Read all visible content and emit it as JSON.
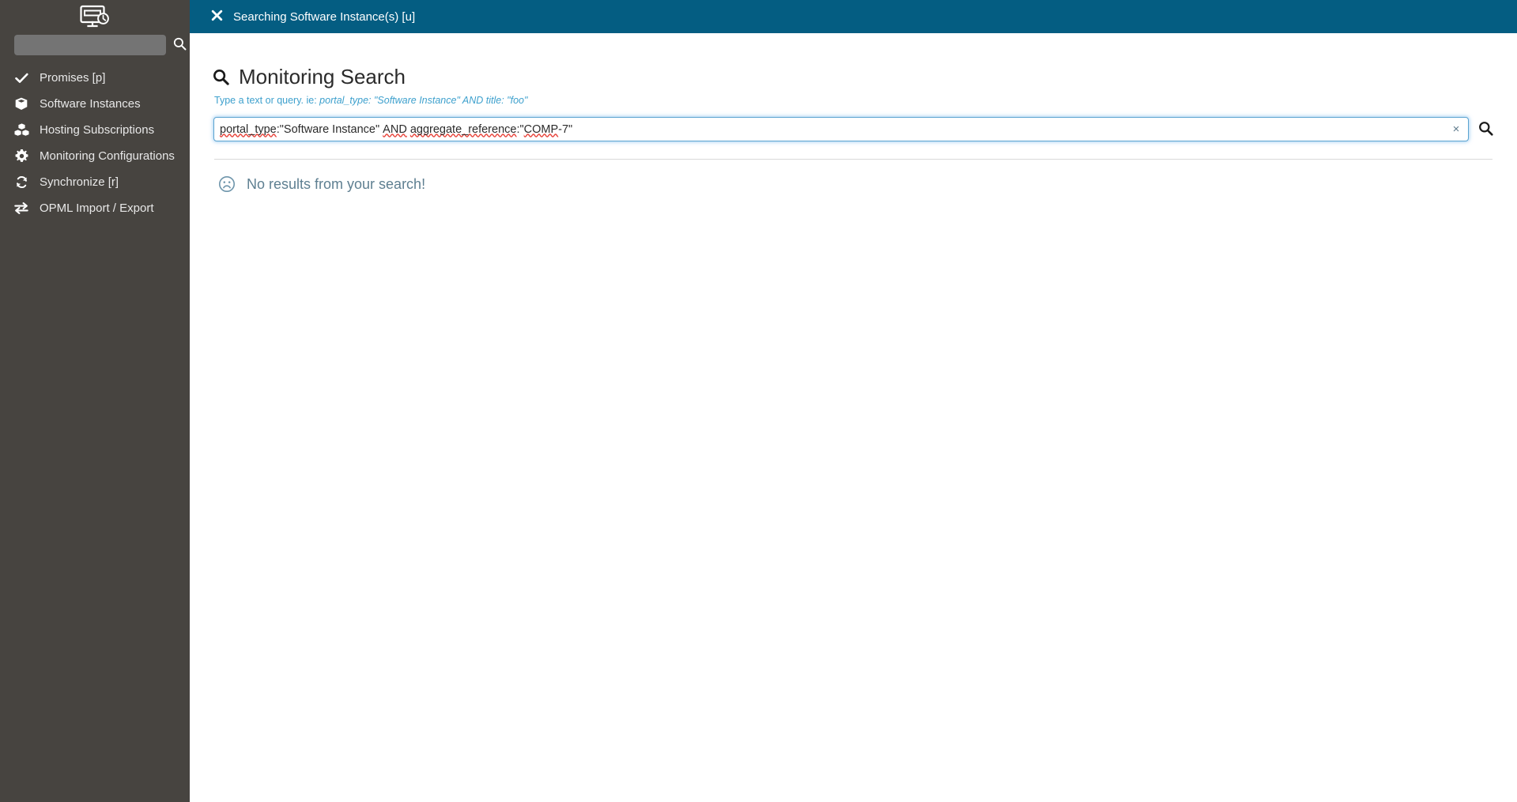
{
  "sidebar": {
    "logo_icon": "monitor-clock-icon",
    "search": {
      "value": "",
      "placeholder": "",
      "icon": "search-icon"
    },
    "items": [
      {
        "label": "Promises [p]",
        "icon": "check-icon"
      },
      {
        "label": "Software Instances",
        "icon": "cube-icon"
      },
      {
        "label": "Hosting Subscriptions",
        "icon": "cubes-icon"
      },
      {
        "label": "Monitoring Configurations",
        "icon": "gear-icon"
      },
      {
        "label": "Synchronize [r]",
        "icon": "sync-icon"
      },
      {
        "label": "OPML Import / Export",
        "icon": "exchange-icon"
      }
    ]
  },
  "topbar": {
    "close_icon": "close-icon",
    "title": "Searching Software Instance(s) [u]"
  },
  "page": {
    "icon": "search-icon",
    "title": "Monitoring Search",
    "hint_prefix": "Type a text or query. ie: ",
    "hint_example": "portal_type: \"Software Instance\" AND title: \"foo\""
  },
  "search": {
    "value": "portal_type:\"Software Instance\" AND aggregate_reference:\"COMP-7\"",
    "placeholder": "",
    "clear_label": "×",
    "clear_icon": "close-icon",
    "submit_icon": "search-icon",
    "tokens": [
      {
        "text": "portal_type",
        "misspelled": true
      },
      {
        "text": ":\"Software Instance\" ",
        "misspelled": false
      },
      {
        "text": "AND",
        "misspelled": true
      },
      {
        "text": " ",
        "misspelled": false
      },
      {
        "text": "aggregate_reference",
        "misspelled": true
      },
      {
        "text": ":\"",
        "misspelled": false
      },
      {
        "text": "COMP",
        "misspelled": true
      },
      {
        "text": "-7\"",
        "misspelled": false
      }
    ]
  },
  "results": {
    "icon": "frown-icon",
    "empty_message": "No results from your search!"
  },
  "colors": {
    "sidebar_bg": "#474440",
    "topbar_bg": "#045d82",
    "accent_link": "#3da0cd",
    "muted_text": "#5e7f91",
    "focus_border": "#5ba3d0",
    "spellcheck": "#e8453c"
  }
}
